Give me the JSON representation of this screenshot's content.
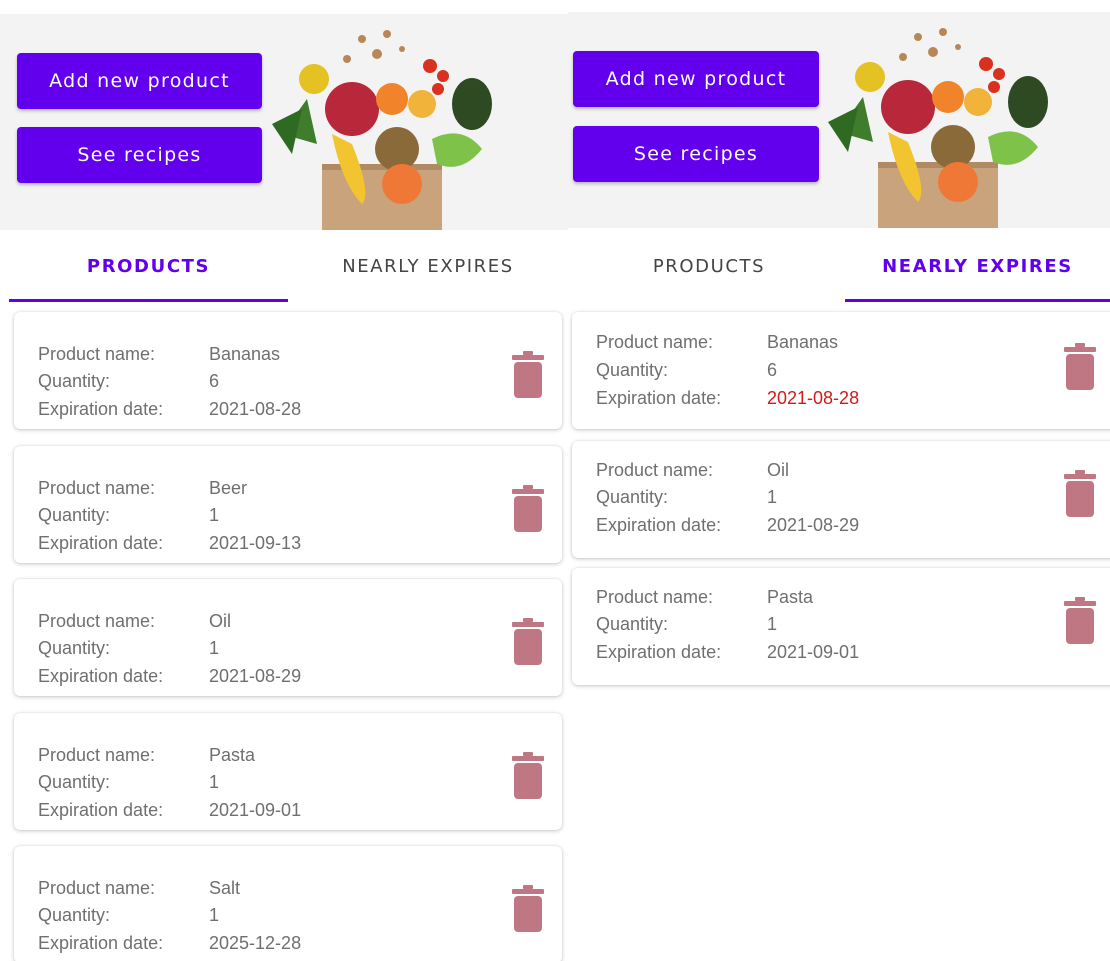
{
  "colors": {
    "primary": "#6200ee",
    "trash": "#c07784",
    "expired": "#d11a1a",
    "text": "#6f6f6f"
  },
  "screens": [
    {
      "buttons": {
        "add": "Add new product",
        "recipes": "See recipes"
      },
      "tabs": [
        {
          "label": "PRODUCTS",
          "active": true
        },
        {
          "label": "NEARLY EXPIRES",
          "active": false
        }
      ],
      "labels": {
        "name": "Product name:",
        "quantity": "Quantity:",
        "expiration": "Expiration date:"
      },
      "products": [
        {
          "name": "Bananas",
          "quantity": "6",
          "expiration": "2021-08-28"
        },
        {
          "name": "Beer",
          "quantity": "1",
          "expiration": "2021-09-13"
        },
        {
          "name": "Oil",
          "quantity": "1",
          "expiration": "2021-08-29"
        },
        {
          "name": "Pasta",
          "quantity": "1",
          "expiration": "2021-09-01"
        },
        {
          "name": "Salt",
          "quantity": "1",
          "expiration": "2025-12-28"
        }
      ],
      "trash_icon": "trash-icon"
    },
    {
      "buttons": {
        "add": "Add new product",
        "recipes": "See recipes"
      },
      "tabs": [
        {
          "label": "PRODUCTS",
          "active": false
        },
        {
          "label": "NEARLY EXPIRES",
          "active": true
        }
      ],
      "labels": {
        "name": "Product name:",
        "quantity": "Quantity:",
        "expiration": "Expiration date:"
      },
      "products": [
        {
          "name": "Bananas",
          "quantity": "6",
          "expiration": "2021-08-28",
          "expired": true
        },
        {
          "name": "Oil",
          "quantity": "1",
          "expiration": "2021-08-29"
        },
        {
          "name": "Pasta",
          "quantity": "1",
          "expiration": "2021-09-01"
        }
      ],
      "trash_icon": "trash-icon"
    }
  ]
}
